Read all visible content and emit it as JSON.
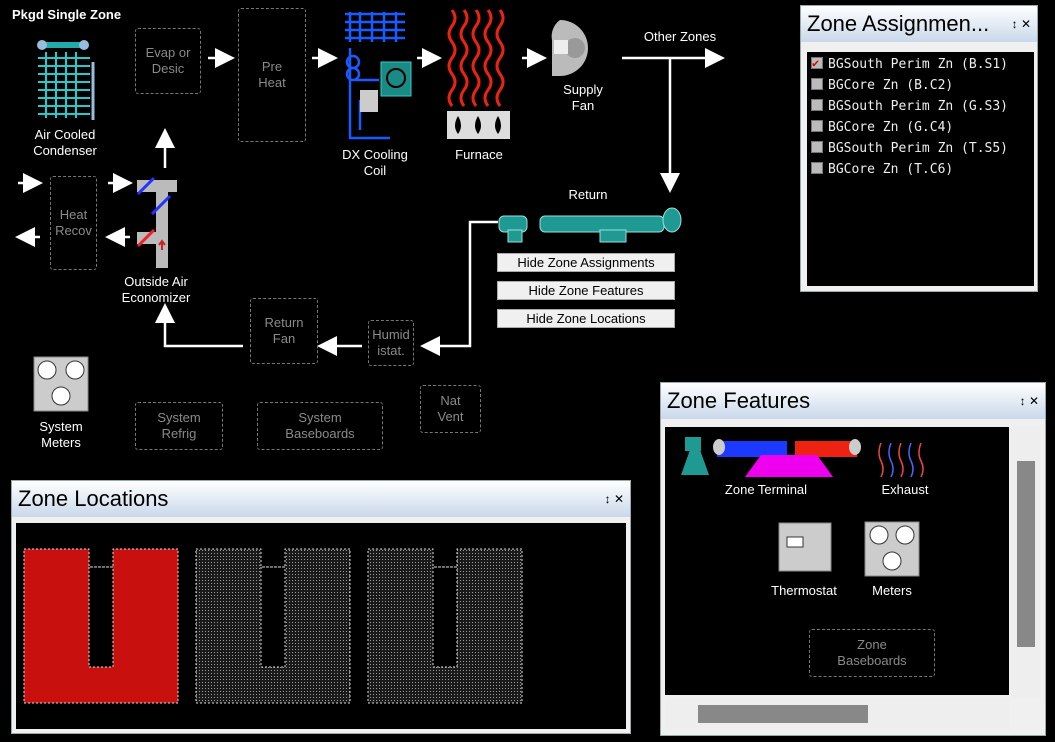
{
  "title": "Pkgd Single Zone",
  "components": {
    "condenser": "Air Cooled\nCondenser",
    "evap": "Evap or\nDesic",
    "preheat": "Pre\nHeat",
    "dx": "DX Cooling\nCoil",
    "furnace": "Furnace",
    "supply_fan": "Supply\nFan",
    "other_zones": "Other Zones",
    "heat_recov": "Heat\nRecov",
    "economizer": "Outside Air\nEconomizer",
    "return": "Return",
    "return_fan": "Return\nFan",
    "humidistat": "Humid\nistat.",
    "system_meters": "System\nMeters",
    "system_refrig": "System\nRefrig",
    "system_baseboards": "System\nBaseboards",
    "nat_vent": "Nat\nVent"
  },
  "buttons": {
    "hide_assign": "Hide Zone Assignments",
    "hide_features": "Hide Zone Features",
    "hide_locations": "Hide Zone Locations"
  },
  "zone_assign": {
    "title": "Zone Assignmen...",
    "items": [
      {
        "label": "BGSouth Perim Zn (B.S1)",
        "checked": true
      },
      {
        "label": "BGCore Zn (B.C2)",
        "checked": false
      },
      {
        "label": "BGSouth Perim Zn (G.S3)",
        "checked": false
      },
      {
        "label": "BGCore Zn (G.C4)",
        "checked": false
      },
      {
        "label": "BGSouth Perim Zn (T.S5)",
        "checked": false
      },
      {
        "label": "BGCore Zn (T.C6)",
        "checked": false
      }
    ]
  },
  "zone_features": {
    "title": "Zone Features",
    "terminal": "Zone Terminal",
    "exhaust": "Exhaust",
    "thermostat": "Thermostat",
    "meters": "Meters",
    "baseboards": "Zone\nBaseboards"
  },
  "zone_locations": {
    "title": "Zone Locations"
  },
  "panel_controls": {
    "pin": "↕",
    "close": "✕"
  },
  "colors": {
    "selected_zone": "#c8100f",
    "accent_teal": "#1e9a93",
    "panel_header": "#c9d8ea"
  }
}
